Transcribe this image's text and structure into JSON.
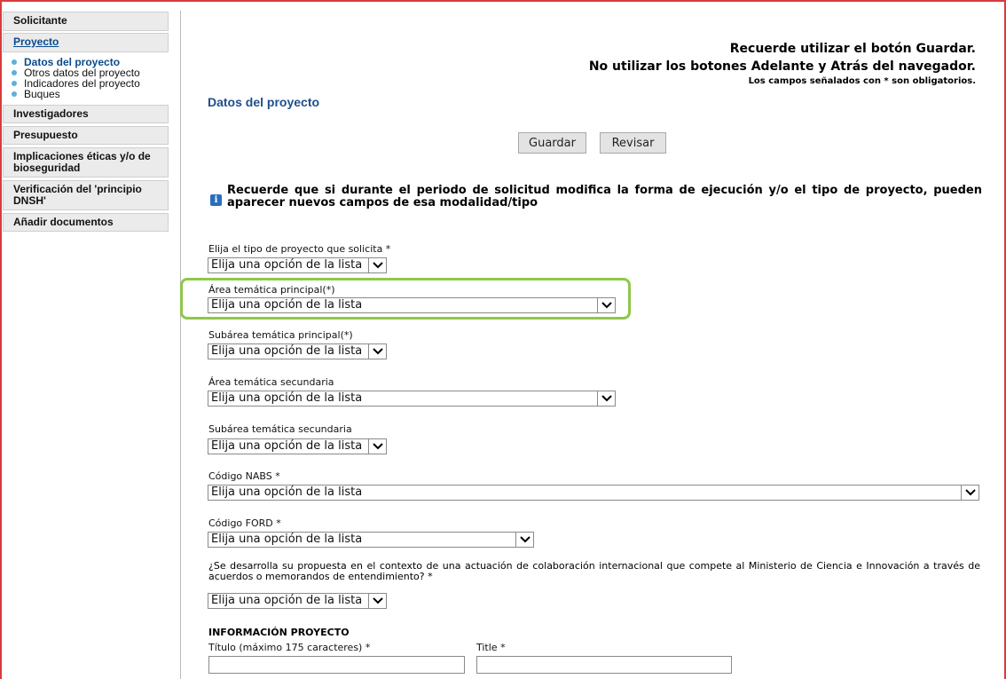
{
  "sidebar": {
    "solicitante": "Solicitante",
    "proyecto": "Proyecto",
    "sub_items": [
      "Datos del proyecto",
      "Otros datos del proyecto",
      "Indicadores del proyecto",
      "Buques"
    ],
    "items": [
      "Investigadores",
      "Presupuesto",
      "Implicaciones éticas y/o de bioseguridad",
      "Verificación del 'principio DNSH'",
      "Añadir documentos"
    ]
  },
  "header": {
    "notice1": "Recuerde utilizar el botón Guardar.",
    "notice2": "No utilizar los botones Adelante y Atrás del navegador.",
    "notice3": "Los campos señalados con * son obligatorios."
  },
  "page_title": "Datos del proyecto",
  "buttons": {
    "save": "Guardar",
    "review": "Revisar"
  },
  "info_text": "Recuerde que si durante el periodo de solicitud modifica la forma de ejecución y/o el tipo de proyecto, pueden aparecer nuevos campos de esa modalidad/tipo",
  "fields": {
    "tipo_proyecto": {
      "label": "Elija el tipo de proyecto que solicita *",
      "value": "Elija una opción de la lista"
    },
    "area_principal": {
      "label": "Área temática principal(*)",
      "value": "Elija una opción de la lista"
    },
    "subarea_principal": {
      "label": "Subárea temática principal(*)",
      "value": "Elija una opción de la lista"
    },
    "area_secundaria": {
      "label": "Área temática secundaria",
      "value": "Elija una opción de la lista"
    },
    "subarea_secundaria": {
      "label": "Subárea temática secundaria",
      "value": "Elija una opción de la lista"
    },
    "nabs": {
      "label": "Código NABS *",
      "value": "Elija una opción de la lista"
    },
    "ford": {
      "label": "Código FORD *",
      "value": "Elija una opción de la lista"
    },
    "colaboracion": {
      "label": "¿Se desarrolla su propuesta en el contexto de una actuación de colaboración internacional que compete al Ministerio de Ciencia e Innovación a través de acuerdos o memorandos de entendimiento? *",
      "value": "Elija una opción de la lista"
    }
  },
  "info_proyecto": {
    "heading": "INFORMACIÓN PROYECTO",
    "titulo_label": "Título (máximo 175 caracteres) *",
    "title_label": "Title *",
    "titulo_value": "",
    "title_value": ""
  },
  "colors": {
    "highlight": "#8ec84a",
    "title": "#1f4e8c",
    "sidebar_link": "#0a4a8c",
    "frame": "#d93b3b"
  }
}
